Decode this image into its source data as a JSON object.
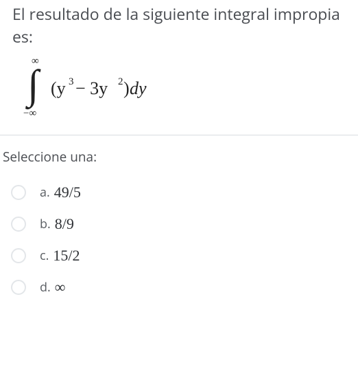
{
  "question": {
    "text": "El resultado de la siguiente integral impropia es:",
    "formula": {
      "upper": "∞",
      "lower": "−∞",
      "integrand_a": "(y",
      "integrand_a_sup": "3",
      "integrand_minus": " − 3y",
      "integrand_b_sup": "2",
      "integrand_close": ")",
      "diff": "dy"
    }
  },
  "prompt": "Seleccione una:",
  "options": [
    {
      "letter": "a.",
      "value": "49/5"
    },
    {
      "letter": "b.",
      "value": "8/9"
    },
    {
      "letter": "c.",
      "value": "15/2"
    },
    {
      "letter": "d.",
      "value": "∞"
    }
  ]
}
